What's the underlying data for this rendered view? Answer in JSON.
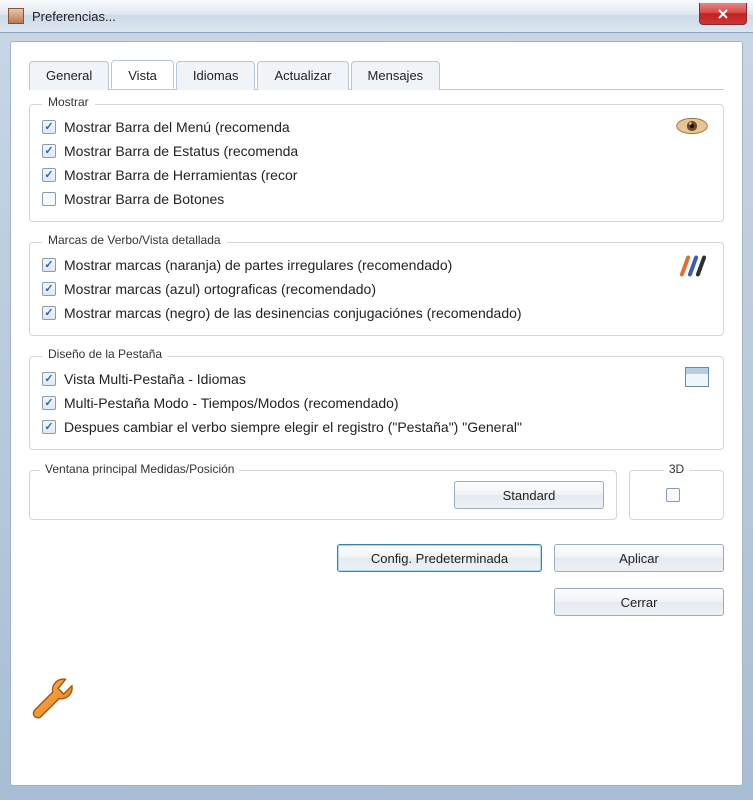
{
  "window": {
    "title": "Preferencias..."
  },
  "tabs": {
    "general": "General",
    "vista": "Vista",
    "idiomas": "Idiomas",
    "actualizar": "Actualizar",
    "mensajes": "Mensajes",
    "active": "vista"
  },
  "group_mostrar": {
    "legend": "Mostrar",
    "items": [
      {
        "label": "Mostrar Barra del Menú (recomenda",
        "checked": true
      },
      {
        "label": "Mostrar Barra de Estatus (recomenda",
        "checked": true
      },
      {
        "label": "Mostrar Barra de Herramientas (recor",
        "checked": true
      },
      {
        "label": "Mostrar Barra de Botones",
        "checked": false
      }
    ]
  },
  "group_marcas": {
    "legend": "Marcas de Verbo/Vista detallada",
    "items": [
      {
        "label": "Mostrar marcas (naranja) de partes irregulares (recomendado)",
        "checked": true
      },
      {
        "label": "Mostrar marcas (azul) ortograficas (recomendado)",
        "checked": true
      },
      {
        "label": "Mostrar marcas (negro) de las desinencias conjugaciónes (recomendado)",
        "checked": true
      }
    ]
  },
  "group_diseno": {
    "legend": "Diseño de la Pestaña",
    "items": [
      {
        "label": "Vista Multi-Pestaña - Idiomas",
        "checked": true
      },
      {
        "label": "Multi-Pestaña Modo - Tiempos/Modos (recomendado)",
        "checked": true
      },
      {
        "label": "Despues cambiar el verbo siempre elegir el registro (\"Pestaña\") \"General\"",
        "checked": true
      }
    ]
  },
  "group_ventana": {
    "legend": "Ventana principal Medidas/Posición",
    "standard_btn": "Standard"
  },
  "group_3d": {
    "legend": "3D",
    "checked": false
  },
  "buttons": {
    "default": "Config. Predeterminada",
    "apply": "Aplicar",
    "close": "Cerrar"
  }
}
